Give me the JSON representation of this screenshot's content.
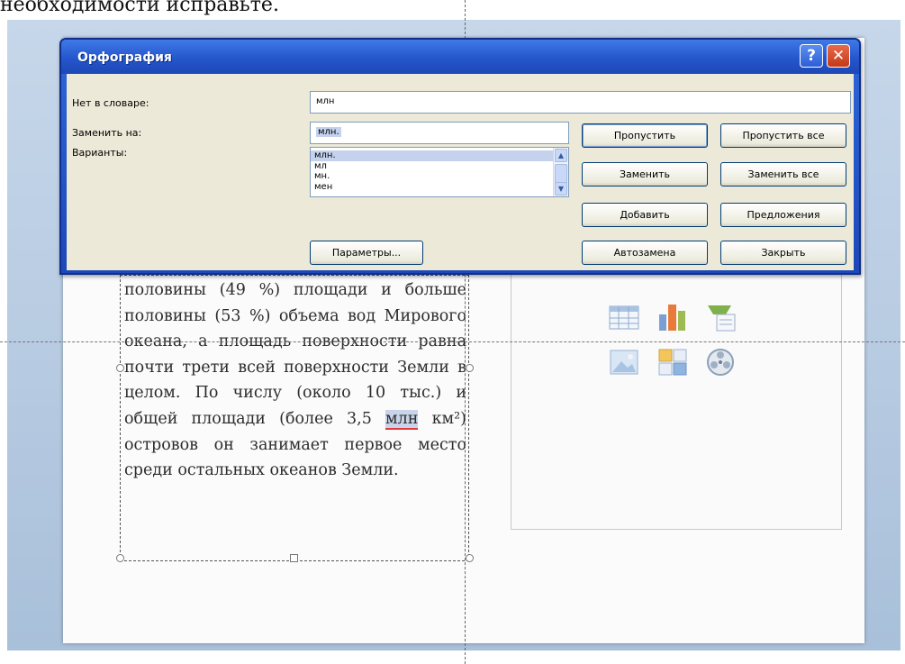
{
  "caption": "необходимости исправьте.",
  "dialog": {
    "title": "Орфография",
    "help_label": "?",
    "close_label": "✕",
    "not_in_dictionary_label": "Нет в словаре:",
    "not_in_dictionary_value": "млн",
    "replace_with_label": "Заменить на:",
    "replace_with_value": "млн.",
    "variants_label": "Варианты:",
    "variants": [
      "млн.",
      "мл",
      "мн.",
      "мен"
    ],
    "buttons": {
      "skip": "Пропустить",
      "skip_all": "Пропустить все",
      "replace": "Заменить",
      "replace_all": "Заменить все",
      "add": "Добавить",
      "suggestions": "Предложения",
      "options": "Параметры...",
      "autocorrect": "Автозамена",
      "close": "Закрыть"
    }
  },
  "slide": {
    "paragraph_before": "половины (49 %) площади и больше половины (53 %) объема вод Мирового океана, а площадь поверхности равна почти трети всей поверхности Земли в целом. По числу (около 10 тыс.) и общей площади (более 3,5",
    "misspelled_word": "млн",
    "paragraph_after": "км²) островов он занимает первое место среди остальных океанов Земли."
  },
  "colors": {
    "title_bar": "#2556cc",
    "dialog_client": "#ece9d8",
    "close_button": "#c43a17"
  },
  "icons": [
    "table-icon",
    "chart-icon",
    "smartart-icon",
    "picture-icon",
    "clipart-icon",
    "media-icon"
  ]
}
